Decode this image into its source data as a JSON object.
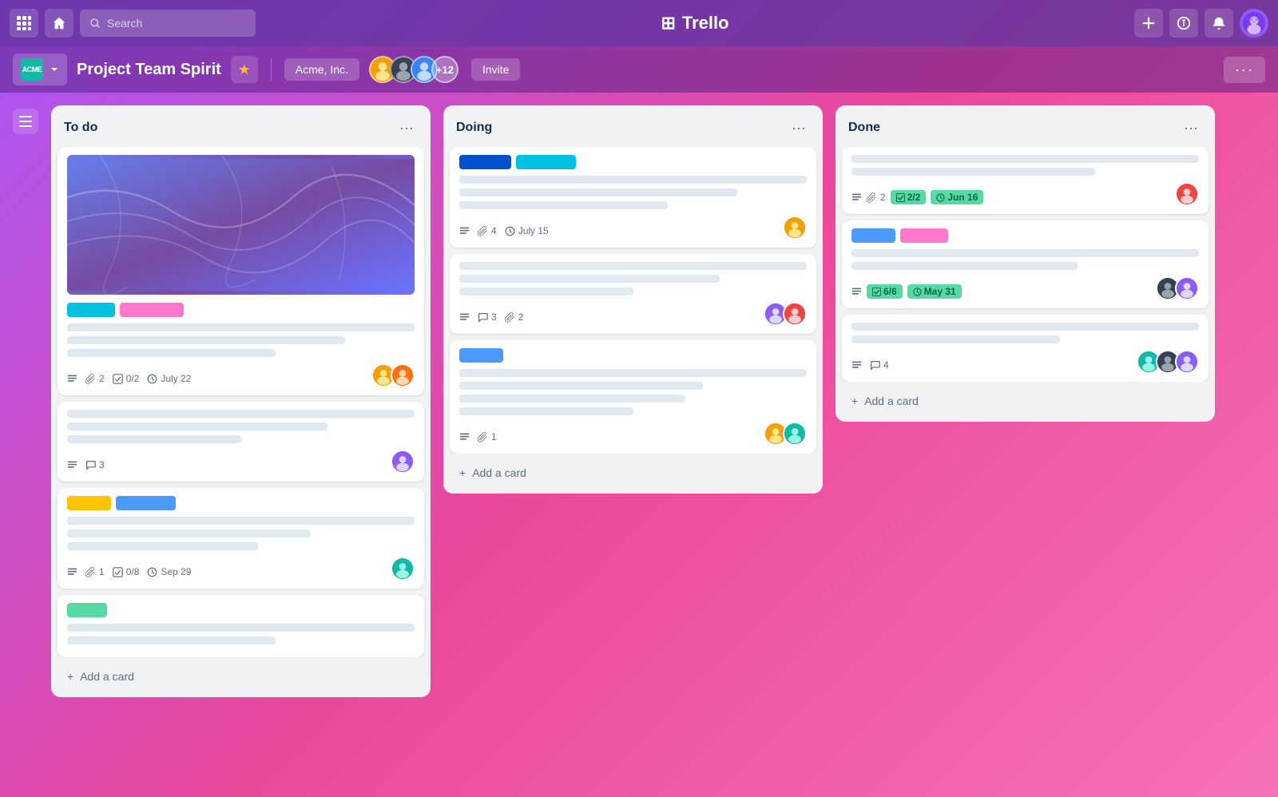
{
  "app": {
    "name": "Trello",
    "logo_symbol": "⊞"
  },
  "nav": {
    "grid_icon": "⊞",
    "home_icon": "⌂",
    "search_placeholder": "Search",
    "add_icon": "+",
    "info_icon": "ℹ",
    "bell_icon": "🔔",
    "more_icon": "···"
  },
  "board": {
    "title": "Project Team Spirit",
    "workspace": "Acme, Inc.",
    "workspace_code": "ACME",
    "member_count": "+12",
    "invite_label": "Invite"
  },
  "columns": [
    {
      "id": "todo",
      "title": "To do",
      "cards": [
        {
          "id": "card1",
          "has_image": true,
          "tags": [
            "#00c2e0",
            "#ff78cb"
          ],
          "tag_labels": [
            "",
            ""
          ],
          "lines": [
            100,
            80,
            60
          ],
          "meta": {
            "description": true,
            "attachments": "2",
            "checklist": "0/2",
            "date": "July 22"
          },
          "avatars": [
            "av-yellow",
            "av-orange"
          ]
        },
        {
          "id": "card2",
          "has_image": false,
          "tags": [],
          "lines": [
            100,
            75,
            50
          ],
          "meta": {
            "description": true,
            "comments": "3"
          },
          "avatars": [
            "av-purple"
          ]
        },
        {
          "id": "card3",
          "has_image": false,
          "tags": [
            "#ffc400",
            "#4c9aff"
          ],
          "tag_labels": [
            "",
            ""
          ],
          "lines": [
            100,
            70,
            55
          ],
          "meta": {
            "description": true,
            "attachments": "1",
            "checklist": "0/8",
            "date": "Sep 29"
          },
          "avatars": [
            "av-teal"
          ]
        },
        {
          "id": "card4",
          "has_image": false,
          "tags": [
            "#57d9a3"
          ],
          "tag_labels": [
            ""
          ],
          "lines": [
            100,
            60
          ],
          "meta": {},
          "avatars": []
        }
      ]
    },
    {
      "id": "doing",
      "title": "Doing",
      "cards": [
        {
          "id": "card5",
          "has_image": false,
          "tags": [
            "#0052cc",
            "#00c2e0"
          ],
          "tag_labels": [
            "",
            ""
          ],
          "lines": [
            100,
            80,
            60
          ],
          "meta": {
            "description": true,
            "attachments": "4",
            "date": "July 15"
          },
          "avatars": [
            "av-yellow"
          ]
        },
        {
          "id": "card6",
          "has_image": false,
          "tags": [],
          "lines": [
            100,
            75,
            50
          ],
          "meta": {
            "description": true,
            "comments": "3",
            "attachments": "2"
          },
          "avatars": [
            "av-purple",
            "av-red"
          ]
        },
        {
          "id": "card7",
          "has_image": false,
          "tags": [
            "#4c9aff"
          ],
          "tag_labels": [
            ""
          ],
          "lines": [
            100,
            70,
            65,
            50
          ],
          "meta": {
            "description": true,
            "attachments": "1"
          },
          "avatars": [
            "av-yellow",
            "av-teal"
          ]
        }
      ]
    },
    {
      "id": "done",
      "title": "Done",
      "cards": [
        {
          "id": "card8",
          "has_image": false,
          "tags": [],
          "lines": [
            100,
            70
          ],
          "meta": {
            "description": true,
            "attachments": "2",
            "checklist_done": "2/2",
            "date_done": "Jun 16"
          },
          "avatars": [
            "av-red"
          ]
        },
        {
          "id": "card9",
          "has_image": false,
          "tags": [
            "#4c9aff",
            "#ec4899"
          ],
          "tag_labels": [
            "",
            ""
          ],
          "lines": [
            100,
            65
          ],
          "meta": {
            "description": true,
            "checklist_done": "6/6",
            "date_done": "May 31"
          },
          "avatars": [
            "av-dark",
            "av-purple"
          ]
        },
        {
          "id": "card10",
          "has_image": false,
          "tags": [],
          "lines": [
            100,
            60
          ],
          "meta": {
            "description": true,
            "comments": "4"
          },
          "avatars": [
            "av-teal",
            "av-dark",
            "av-purple"
          ]
        }
      ]
    }
  ],
  "labels": {
    "add_card": "+ Add a card",
    "show_menu": "···"
  }
}
